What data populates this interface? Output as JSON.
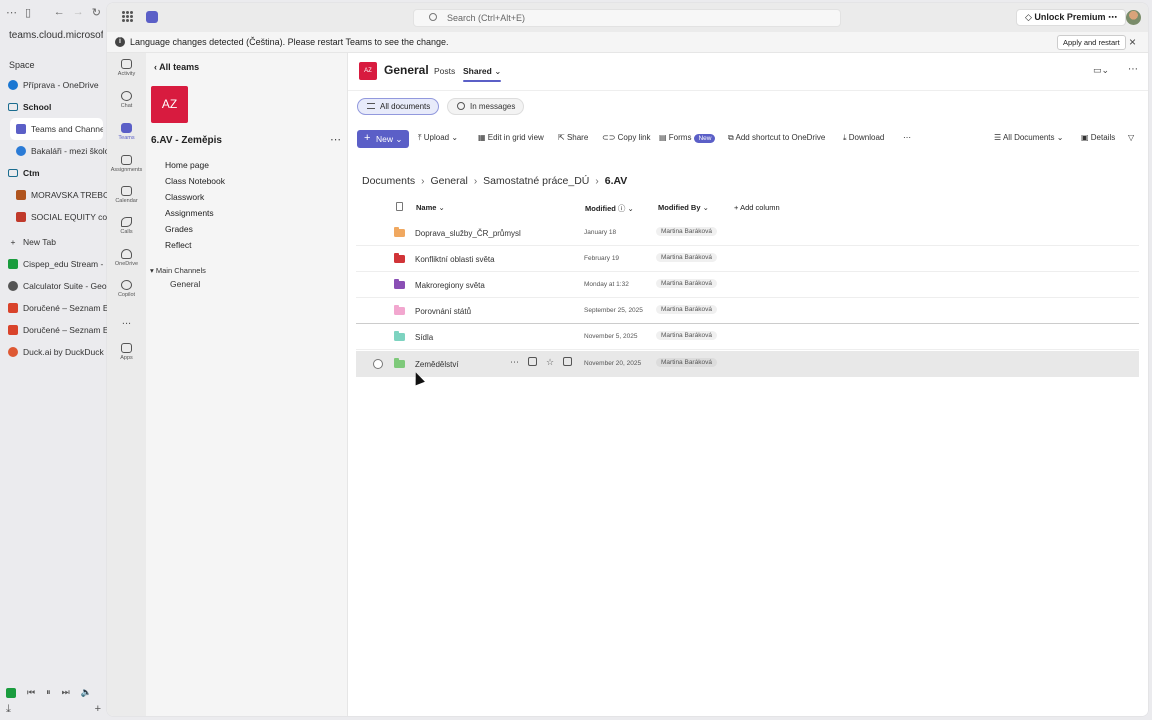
{
  "browser": {
    "url": "teams.cloud.microsoft",
    "space_label": "Space",
    "items": [
      {
        "label": "Příprava - OneDrive",
        "color": "#1976d2"
      },
      {
        "label": "School",
        "folder": true
      },
      {
        "label": "Teams and Channe",
        "color": "#5b5fc7",
        "active": true
      },
      {
        "label": "Bakaláři - mezi školo",
        "color": "#2b7bd6"
      },
      {
        "label": "Ctm",
        "folder": true
      },
      {
        "label": "MORAVSKA TREBO",
        "color": "#b0541e"
      },
      {
        "label": "SOCIAL EQUITY co",
        "color": "#c0392b"
      },
      {
        "label": "New Tab",
        "new": true
      },
      {
        "label": "Cispep_edu Stream -",
        "color": "#1a9c3e"
      },
      {
        "label": "Calculator Suite - Geo",
        "color": "#555555"
      },
      {
        "label": "Doručené – Seznam E",
        "color": "#d9432b"
      },
      {
        "label": "Doručené – Seznam E",
        "color": "#d9432b"
      },
      {
        "label": "Duck.ai by DuckDuck",
        "color": "#de5833"
      }
    ]
  },
  "teams": {
    "search_placeholder": "Search (Ctrl+Alt+E)",
    "premium_label": "Unlock Premium",
    "notice_text": "Language changes detected (Čeština). Please restart Teams to see the change.",
    "apply_label": "Apply and restart",
    "rail": [
      {
        "label": "Activity",
        "active": false
      },
      {
        "label": "Chat",
        "active": false
      },
      {
        "label": "Teams",
        "active": true
      },
      {
        "label": "Assignments",
        "active": false
      },
      {
        "label": "Calendar",
        "active": false
      },
      {
        "label": "Calls",
        "active": false
      },
      {
        "label": "OneDrive",
        "active": false
      },
      {
        "label": "Copilot",
        "active": false
      },
      {
        "label": "...",
        "active": false
      },
      {
        "label": "Apps",
        "active": false
      }
    ],
    "back_label": "All teams",
    "team_initials": "AZ",
    "team_name": "6.AV - Zeměpis",
    "team_nav": [
      "Home page",
      "Class Notebook",
      "Classwork",
      "Assignments",
      "Grades",
      "Reflect"
    ],
    "channels_header": "Main Channels",
    "channel_general": "General"
  },
  "channel": {
    "initials": "AZ",
    "title": "General",
    "tab_posts": "Posts",
    "tab_shared": "Shared",
    "pill_all": "All documents",
    "pill_messages": "In messages"
  },
  "toolbar": {
    "new": "New",
    "upload": "Upload",
    "edit_grid": "Edit in grid view",
    "share": "Share",
    "copy_link": "Copy link",
    "forms": "Forms",
    "forms_badge": "New",
    "add_shortcut": "Add shortcut to OneDrive",
    "download": "Download",
    "all_documents": "All Documents",
    "details": "Details"
  },
  "breadcrumb": [
    "Documents",
    "General",
    "Samostatné práce_DÚ",
    "6.AV"
  ],
  "table": {
    "col_name": "Name",
    "col_modified": "Modified",
    "col_modified_by": "Modified By",
    "add_column": "Add column",
    "rows": [
      {
        "name": "Doprava_služby_ČR_průmysl",
        "modified": "January 18",
        "by": "Martina Baráková",
        "color": "#f0a860"
      },
      {
        "name": "Konfliktní oblasti světa",
        "modified": "February 19",
        "by": "Martina Baráková",
        "color": "#d13438"
      },
      {
        "name": "Makroregiony světa",
        "modified": "Monday at 1:32",
        "by": "Martina Baráková",
        "color": "#8a4fb5"
      },
      {
        "name": "Porovnání států",
        "modified": "September 25, 2025",
        "by": "Martina Baráková",
        "color": "#f2a7cf"
      },
      {
        "name": "Sídla",
        "modified": "November 5, 2025",
        "by": "Martina Baráková",
        "color": "#7dd3c0"
      },
      {
        "name": "Zemědělství",
        "modified": "November 20, 2025",
        "by": "Martina Baráková",
        "color": "#7ec97a"
      }
    ]
  }
}
